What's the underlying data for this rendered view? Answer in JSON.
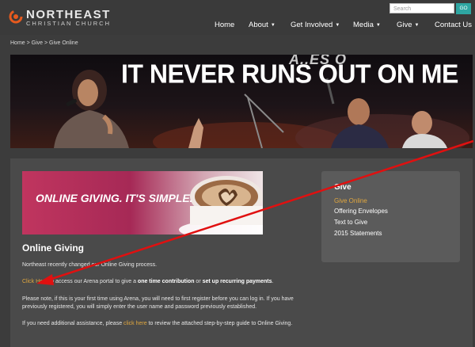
{
  "header": {
    "logo": {
      "name": "NORTHEAST",
      "sub": "CHRISTIAN CHURCH"
    },
    "search": {
      "placeholder": "Search",
      "go": "GO"
    },
    "nav": [
      {
        "label": "Home",
        "dropdown": false
      },
      {
        "label": "About",
        "dropdown": true
      },
      {
        "label": "Get Involved",
        "dropdown": true
      },
      {
        "label": "Media",
        "dropdown": true
      },
      {
        "label": "Give",
        "dropdown": true
      },
      {
        "label": "Contact Us",
        "dropdown": false
      }
    ],
    "caret": "▼"
  },
  "breadcrumb": "Home > Give > Give Online",
  "hero": {
    "text": "IT NEVER RUNS OUT ON ME",
    "top_text": "A..ES O"
  },
  "promo": {
    "text": "ONLINE GIVING. IT'S SIMPLE."
  },
  "main": {
    "heading": "Online Giving",
    "p1": "Northeast recently changed our Online Giving process.",
    "p2": {
      "link": "Click Here",
      "t1": " to access our Arena portal to give a ",
      "b1": "one time contribution",
      "t2": " or ",
      "b2": "set up recurring payments",
      "t3": "."
    },
    "p3": "Please note, if this is your first time using Arena, you will need to first register before you can log in.  If you have previously registered, you will simply enter the user name and password previously established.",
    "p4": {
      "t1": "If you need additional assistance, please ",
      "link": "click here",
      "t2": " to review the attached step-by-step guide to Online Giving."
    }
  },
  "sidebar": {
    "title": "Give",
    "items": [
      {
        "label": "Give Online",
        "active": true
      },
      {
        "label": "Offering Envelopes",
        "active": false
      },
      {
        "label": "Text to Give",
        "active": false
      },
      {
        "label": "2015 Statements",
        "active": false
      }
    ]
  },
  "colors": {
    "accent_link": "#e0a73f",
    "go_button": "#2ea6a2",
    "annotation_arrow": "#e01010"
  }
}
